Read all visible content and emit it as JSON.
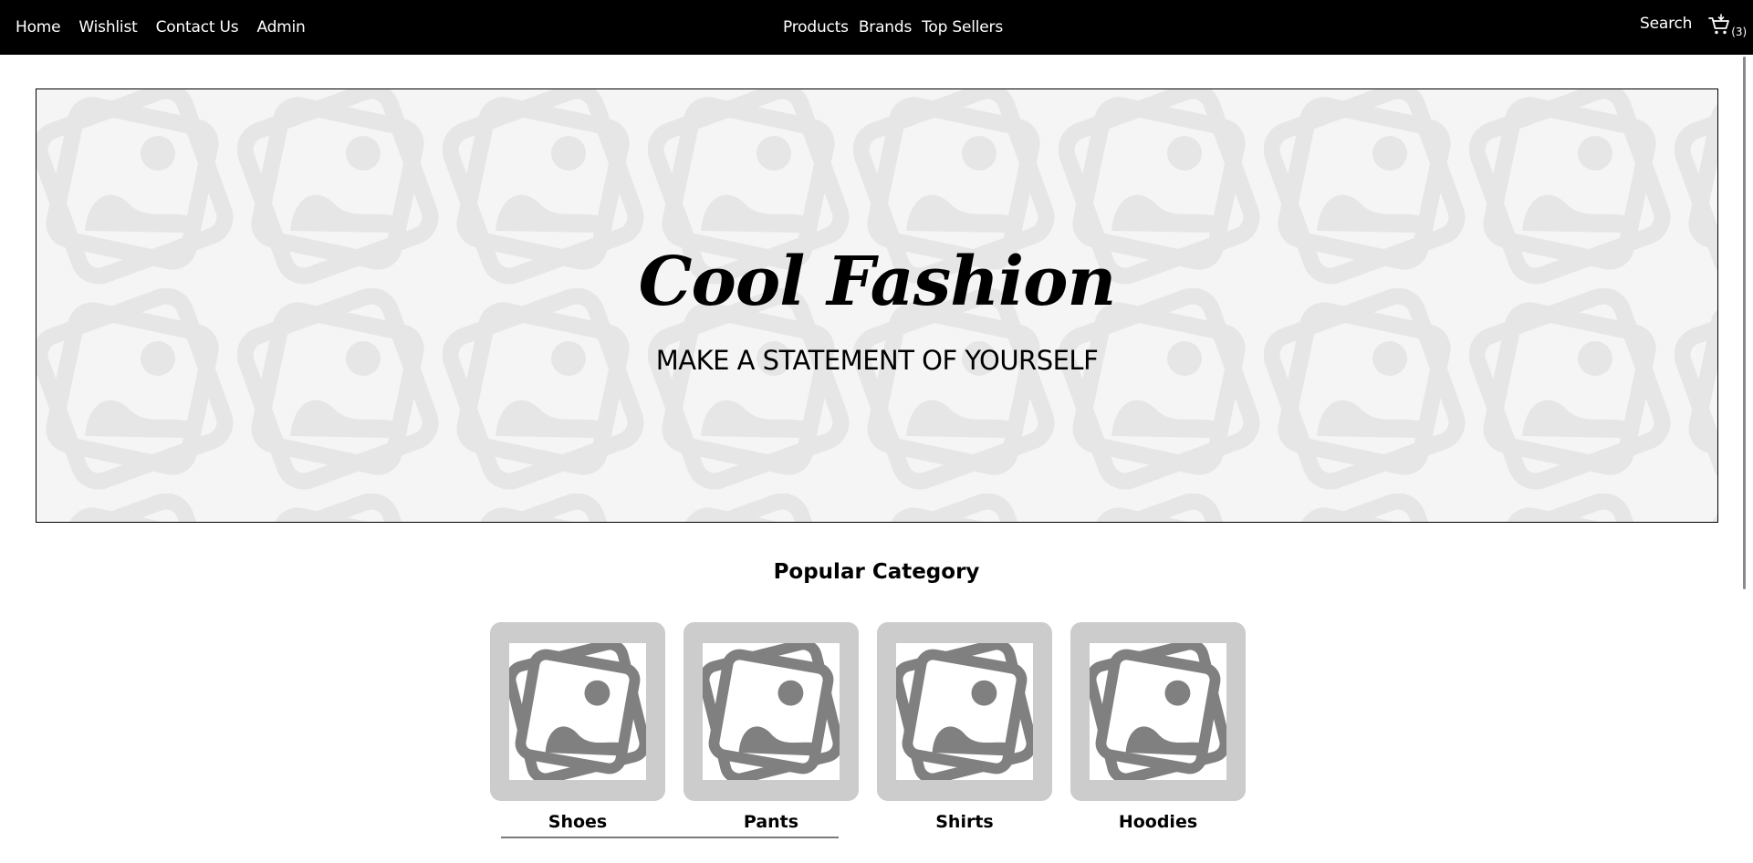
{
  "nav": {
    "left_links": [
      "Home",
      "Wishlist",
      "Contact Us",
      "Admin"
    ],
    "center_links": [
      "Products",
      "Brands",
      "Top Sellers"
    ],
    "search_label": "Search",
    "cart_icon": "cart-icon",
    "cart_count": "(3)"
  },
  "hero": {
    "title": "Cool Fashion",
    "subtitle": "MAKE A STATEMENT OF YOURSELF",
    "background_icon": "image-placeholder-icon"
  },
  "categories": {
    "title": "Popular Category",
    "items": [
      {
        "label": "Shoes",
        "icon": "image-placeholder-icon"
      },
      {
        "label": "Pants",
        "icon": "image-placeholder-icon"
      },
      {
        "label": "Shirts",
        "icon": "image-placeholder-icon"
      },
      {
        "label": "Hoodies",
        "icon": "image-placeholder-icon"
      }
    ]
  },
  "colors": {
    "nav_bg": "#000000",
    "nav_text": "#ffffff",
    "hero_bg": "#f5f5f5",
    "pattern": "#e6e6e6",
    "thumb_frame": "#cccccc",
    "placeholder_icon": "#808080"
  }
}
